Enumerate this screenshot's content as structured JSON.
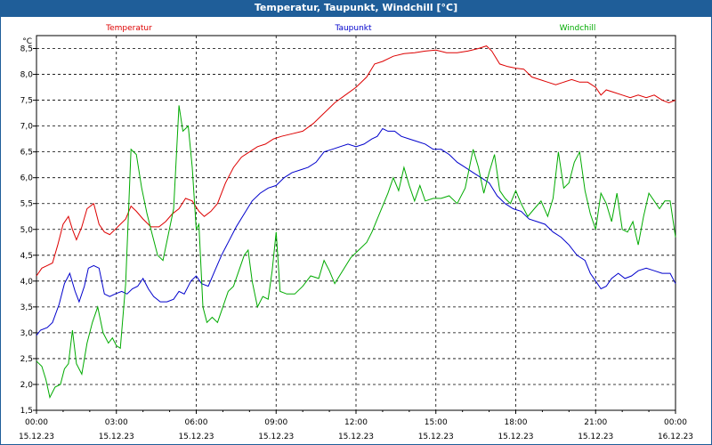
{
  "window": {
    "title": "Temperatur, Taupunkt, Windchill [°C]"
  },
  "chart_data": {
    "type": "line",
    "title": "Temperatur, Taupunkt, Windchill [°C]",
    "ylabel": "°C",
    "ylim": [
      1.5,
      8.75
    ],
    "yticks": [
      "1,5",
      "2,0",
      "2,5",
      "3,0",
      "3,5",
      "4,0",
      "4,5",
      "5,0",
      "5,5",
      "6,0",
      "6,5",
      "7,0",
      "7,5",
      "8,0",
      "8,5"
    ],
    "xlim_hours": [
      0,
      24
    ],
    "xticks": [
      {
        "time": "00:00",
        "date": "15.12.23"
      },
      {
        "time": "03:00",
        "date": "15.12.23"
      },
      {
        "time": "06:00",
        "date": "15.12.23"
      },
      {
        "time": "09:00",
        "date": "15.12.23"
      },
      {
        "time": "12:00",
        "date": "15.12.23"
      },
      {
        "time": "15:00",
        "date": "15.12.23"
      },
      {
        "time": "18:00",
        "date": "15.12.23"
      },
      {
        "time": "21:00",
        "date": "15.12.23"
      },
      {
        "time": "00:00",
        "date": "16.12.23"
      }
    ],
    "grid": true,
    "legend_position": "top",
    "series": [
      {
        "name": "Temperatur",
        "color": "#dd0000",
        "points": [
          [
            0,
            4.1
          ],
          [
            0.2,
            4.25
          ],
          [
            0.4,
            4.3
          ],
          [
            0.6,
            4.35
          ],
          [
            0.8,
            4.7
          ],
          [
            1.0,
            5.1
          ],
          [
            1.2,
            5.25
          ],
          [
            1.35,
            5.0
          ],
          [
            1.5,
            4.8
          ],
          [
            1.7,
            5.05
          ],
          [
            1.9,
            5.4
          ],
          [
            2.15,
            5.5
          ],
          [
            2.35,
            5.1
          ],
          [
            2.55,
            4.95
          ],
          [
            2.75,
            4.9
          ],
          [
            2.95,
            5.0
          ],
          [
            3.15,
            5.1
          ],
          [
            3.35,
            5.2
          ],
          [
            3.55,
            5.45
          ],
          [
            3.75,
            5.35
          ],
          [
            4.0,
            5.2
          ],
          [
            4.3,
            5.05
          ],
          [
            4.6,
            5.05
          ],
          [
            4.85,
            5.15
          ],
          [
            5.1,
            5.3
          ],
          [
            5.35,
            5.4
          ],
          [
            5.6,
            5.6
          ],
          [
            5.85,
            5.55
          ],
          [
            6.1,
            5.35
          ],
          [
            6.3,
            5.25
          ],
          [
            6.55,
            5.35
          ],
          [
            6.8,
            5.5
          ],
          [
            7.1,
            5.9
          ],
          [
            7.4,
            6.2
          ],
          [
            7.7,
            6.4
          ],
          [
            8.0,
            6.5
          ],
          [
            8.3,
            6.6
          ],
          [
            8.6,
            6.65
          ],
          [
            8.9,
            6.75
          ],
          [
            9.2,
            6.8
          ],
          [
            9.6,
            6.85
          ],
          [
            10.0,
            6.9
          ],
          [
            10.4,
            7.05
          ],
          [
            10.8,
            7.25
          ],
          [
            11.2,
            7.45
          ],
          [
            11.6,
            7.6
          ],
          [
            12.0,
            7.75
          ],
          [
            12.4,
            7.95
          ],
          [
            12.7,
            8.2
          ],
          [
            13.0,
            8.25
          ],
          [
            13.4,
            8.35
          ],
          [
            13.8,
            8.4
          ],
          [
            14.2,
            8.42
          ],
          [
            14.6,
            8.45
          ],
          [
            15.0,
            8.47
          ],
          [
            15.4,
            8.42
          ],
          [
            15.8,
            8.42
          ],
          [
            16.2,
            8.45
          ],
          [
            16.6,
            8.5
          ],
          [
            16.9,
            8.55
          ],
          [
            17.1,
            8.45
          ],
          [
            17.4,
            8.2
          ],
          [
            17.7,
            8.15
          ],
          [
            18.0,
            8.12
          ],
          [
            18.3,
            8.1
          ],
          [
            18.6,
            7.95
          ],
          [
            18.9,
            7.9
          ],
          [
            19.2,
            7.85
          ],
          [
            19.5,
            7.8
          ],
          [
            19.8,
            7.85
          ],
          [
            20.1,
            7.9
          ],
          [
            20.4,
            7.85
          ],
          [
            20.7,
            7.85
          ],
          [
            21.0,
            7.75
          ],
          [
            21.2,
            7.6
          ],
          [
            21.4,
            7.7
          ],
          [
            21.7,
            7.65
          ],
          [
            22.0,
            7.6
          ],
          [
            22.3,
            7.55
          ],
          [
            22.6,
            7.6
          ],
          [
            22.9,
            7.55
          ],
          [
            23.2,
            7.6
          ],
          [
            23.5,
            7.5
          ],
          [
            23.75,
            7.45
          ],
          [
            24.0,
            7.5
          ]
        ]
      },
      {
        "name": "Taupunkt",
        "color": "#0000cc",
        "points": [
          [
            0,
            2.95
          ],
          [
            0.15,
            3.05
          ],
          [
            0.4,
            3.1
          ],
          [
            0.6,
            3.2
          ],
          [
            0.85,
            3.55
          ],
          [
            1.05,
            3.95
          ],
          [
            1.25,
            4.15
          ],
          [
            1.45,
            3.8
          ],
          [
            1.6,
            3.6
          ],
          [
            1.8,
            3.9
          ],
          [
            1.95,
            4.25
          ],
          [
            2.15,
            4.3
          ],
          [
            2.35,
            4.25
          ],
          [
            2.55,
            3.75
          ],
          [
            2.75,
            3.7
          ],
          [
            2.95,
            3.75
          ],
          [
            3.2,
            3.8
          ],
          [
            3.4,
            3.75
          ],
          [
            3.6,
            3.85
          ],
          [
            3.8,
            3.9
          ],
          [
            4.0,
            4.05
          ],
          [
            4.2,
            3.85
          ],
          [
            4.4,
            3.7
          ],
          [
            4.65,
            3.6
          ],
          [
            4.9,
            3.6
          ],
          [
            5.15,
            3.65
          ],
          [
            5.35,
            3.8
          ],
          [
            5.55,
            3.75
          ],
          [
            5.8,
            4.0
          ],
          [
            6.0,
            4.1
          ],
          [
            6.2,
            3.95
          ],
          [
            6.45,
            3.9
          ],
          [
            6.7,
            4.2
          ],
          [
            6.95,
            4.5
          ],
          [
            7.2,
            4.75
          ],
          [
            7.5,
            5.05
          ],
          [
            7.8,
            5.3
          ],
          [
            8.1,
            5.55
          ],
          [
            8.4,
            5.7
          ],
          [
            8.7,
            5.8
          ],
          [
            9.0,
            5.85
          ],
          [
            9.3,
            6.0
          ],
          [
            9.6,
            6.1
          ],
          [
            9.9,
            6.15
          ],
          [
            10.2,
            6.2
          ],
          [
            10.5,
            6.3
          ],
          [
            10.8,
            6.5
          ],
          [
            11.1,
            6.55
          ],
          [
            11.4,
            6.6
          ],
          [
            11.7,
            6.65
          ],
          [
            12.0,
            6.6
          ],
          [
            12.3,
            6.65
          ],
          [
            12.6,
            6.75
          ],
          [
            12.8,
            6.8
          ],
          [
            13.0,
            6.95
          ],
          [
            13.2,
            6.9
          ],
          [
            13.45,
            6.9
          ],
          [
            13.7,
            6.8
          ],
          [
            14.0,
            6.75
          ],
          [
            14.3,
            6.7
          ],
          [
            14.6,
            6.65
          ],
          [
            14.9,
            6.55
          ],
          [
            15.2,
            6.55
          ],
          [
            15.5,
            6.45
          ],
          [
            15.8,
            6.3
          ],
          [
            16.1,
            6.2
          ],
          [
            16.4,
            6.1
          ],
          [
            16.7,
            6.0
          ],
          [
            17.0,
            5.9
          ],
          [
            17.3,
            5.65
          ],
          [
            17.6,
            5.5
          ],
          [
            17.9,
            5.4
          ],
          [
            18.2,
            5.35
          ],
          [
            18.5,
            5.2
          ],
          [
            18.8,
            5.15
          ],
          [
            19.1,
            5.1
          ],
          [
            19.4,
            4.95
          ],
          [
            19.7,
            4.85
          ],
          [
            20.0,
            4.7
          ],
          [
            20.3,
            4.5
          ],
          [
            20.6,
            4.4
          ],
          [
            20.8,
            4.15
          ],
          [
            21.0,
            4.0
          ],
          [
            21.2,
            3.85
          ],
          [
            21.4,
            3.9
          ],
          [
            21.6,
            4.05
          ],
          [
            21.85,
            4.15
          ],
          [
            22.1,
            4.05
          ],
          [
            22.35,
            4.1
          ],
          [
            22.6,
            4.2
          ],
          [
            22.9,
            4.25
          ],
          [
            23.2,
            4.2
          ],
          [
            23.5,
            4.15
          ],
          [
            23.8,
            4.15
          ],
          [
            24.0,
            3.95
          ]
        ]
      },
      {
        "name": "Windchill",
        "color": "#00aa00",
        "points": [
          [
            0,
            2.45
          ],
          [
            0.2,
            2.35
          ],
          [
            0.35,
            2.1
          ],
          [
            0.5,
            1.75
          ],
          [
            0.7,
            1.95
          ],
          [
            0.9,
            2.0
          ],
          [
            1.05,
            2.3
          ],
          [
            1.2,
            2.4
          ],
          [
            1.35,
            3.05
          ],
          [
            1.5,
            2.4
          ],
          [
            1.7,
            2.2
          ],
          [
            1.9,
            2.8
          ],
          [
            2.1,
            3.2
          ],
          [
            2.3,
            3.5
          ],
          [
            2.5,
            3.0
          ],
          [
            2.7,
            2.8
          ],
          [
            2.85,
            2.9
          ],
          [
            3.0,
            2.75
          ],
          [
            3.15,
            2.7
          ],
          [
            3.35,
            3.95
          ],
          [
            3.55,
            6.55
          ],
          [
            3.75,
            6.45
          ],
          [
            3.95,
            5.8
          ],
          [
            4.15,
            5.3
          ],
          [
            4.35,
            4.9
          ],
          [
            4.55,
            4.5
          ],
          [
            4.75,
            4.4
          ],
          [
            4.95,
            4.9
          ],
          [
            5.15,
            5.4
          ],
          [
            5.35,
            7.4
          ],
          [
            5.5,
            6.9
          ],
          [
            5.7,
            7.0
          ],
          [
            5.85,
            6.2
          ],
          [
            6.0,
            5.0
          ],
          [
            6.1,
            5.1
          ],
          [
            6.25,
            3.5
          ],
          [
            6.4,
            3.2
          ],
          [
            6.6,
            3.3
          ],
          [
            6.8,
            3.2
          ],
          [
            7.0,
            3.5
          ],
          [
            7.2,
            3.8
          ],
          [
            7.4,
            3.9
          ],
          [
            7.6,
            4.2
          ],
          [
            7.8,
            4.5
          ],
          [
            7.95,
            4.6
          ],
          [
            8.1,
            4.0
          ],
          [
            8.3,
            3.5
          ],
          [
            8.5,
            3.7
          ],
          [
            8.7,
            3.65
          ],
          [
            8.85,
            4.2
          ],
          [
            9.0,
            4.95
          ],
          [
            9.15,
            3.8
          ],
          [
            9.4,
            3.75
          ],
          [
            9.7,
            3.75
          ],
          [
            10.0,
            3.9
          ],
          [
            10.3,
            4.1
          ],
          [
            10.6,
            4.05
          ],
          [
            10.8,
            4.4
          ],
          [
            11.0,
            4.2
          ],
          [
            11.2,
            3.95
          ],
          [
            11.5,
            4.2
          ],
          [
            11.8,
            4.45
          ],
          [
            12.1,
            4.6
          ],
          [
            12.4,
            4.75
          ],
          [
            12.6,
            4.95
          ],
          [
            12.8,
            5.2
          ],
          [
            13.0,
            5.45
          ],
          [
            13.2,
            5.7
          ],
          [
            13.4,
            6.0
          ],
          [
            13.6,
            5.75
          ],
          [
            13.8,
            6.2
          ],
          [
            14.0,
            5.85
          ],
          [
            14.2,
            5.55
          ],
          [
            14.4,
            5.85
          ],
          [
            14.6,
            5.55
          ],
          [
            14.9,
            5.6
          ],
          [
            15.2,
            5.6
          ],
          [
            15.5,
            5.65
          ],
          [
            15.8,
            5.5
          ],
          [
            16.1,
            5.8
          ],
          [
            16.4,
            6.55
          ],
          [
            16.6,
            6.2
          ],
          [
            16.8,
            5.7
          ],
          [
            17.0,
            6.1
          ],
          [
            17.2,
            6.45
          ],
          [
            17.4,
            5.75
          ],
          [
            17.6,
            5.6
          ],
          [
            17.8,
            5.5
          ],
          [
            18.0,
            5.75
          ],
          [
            18.2,
            5.5
          ],
          [
            18.45,
            5.25
          ],
          [
            18.7,
            5.4
          ],
          [
            18.95,
            5.55
          ],
          [
            19.2,
            5.25
          ],
          [
            19.4,
            5.6
          ],
          [
            19.6,
            6.5
          ],
          [
            19.8,
            5.8
          ],
          [
            20.0,
            5.9
          ],
          [
            20.2,
            6.3
          ],
          [
            20.4,
            6.5
          ],
          [
            20.6,
            5.75
          ],
          [
            20.8,
            5.3
          ],
          [
            21.0,
            5.0
          ],
          [
            21.2,
            5.7
          ],
          [
            21.4,
            5.5
          ],
          [
            21.6,
            5.15
          ],
          [
            21.8,
            5.7
          ],
          [
            22.0,
            5.0
          ],
          [
            22.2,
            4.95
          ],
          [
            22.4,
            5.15
          ],
          [
            22.6,
            4.7
          ],
          [
            22.8,
            5.25
          ],
          [
            23.0,
            5.7
          ],
          [
            23.2,
            5.55
          ],
          [
            23.4,
            5.4
          ],
          [
            23.6,
            5.55
          ],
          [
            23.8,
            5.55
          ],
          [
            24.0,
            4.85
          ]
        ]
      }
    ]
  }
}
